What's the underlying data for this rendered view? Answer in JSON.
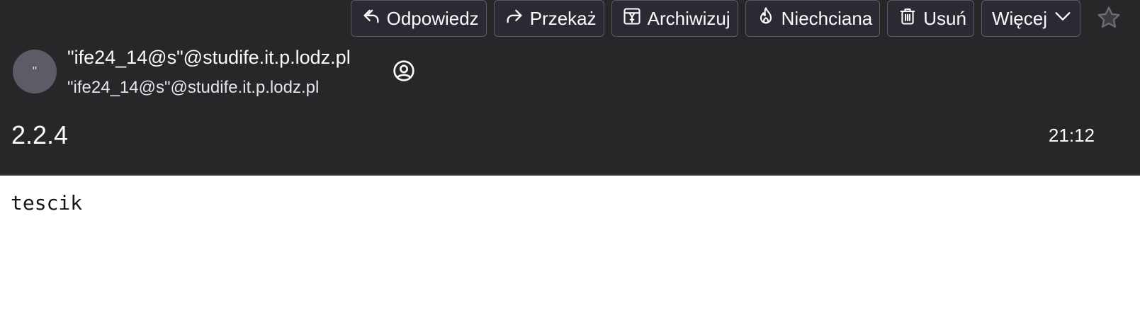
{
  "toolbar": {
    "reply_label": "Odpowiedz",
    "forward_label": "Przekaż",
    "archive_label": "Archiwizuj",
    "junk_label": "Niechciana",
    "delete_label": "Usuń",
    "more_label": "Więcej"
  },
  "message": {
    "avatar_initial": "\"",
    "from_name": "\"ife24_14@s\"@studife.it.p.lodz.pl",
    "from_address": "\"ife24_14@s\"@studife.it.p.lodz.pl",
    "subject": "2.2.4",
    "time": "21:12",
    "body": "tescik"
  },
  "colors": {
    "header_bg": "#27272a",
    "button_bg": "#2b2a33",
    "button_border": "#5b5b66",
    "text_light": "#fbfbfe",
    "avatar_bg": "#5c5c66",
    "body_bg": "#ffffff"
  },
  "icons": [
    "reply-icon",
    "forward-icon",
    "archive-icon",
    "junk-icon",
    "trash-icon",
    "chevron-down-icon",
    "star-icon",
    "contact-icon"
  ]
}
